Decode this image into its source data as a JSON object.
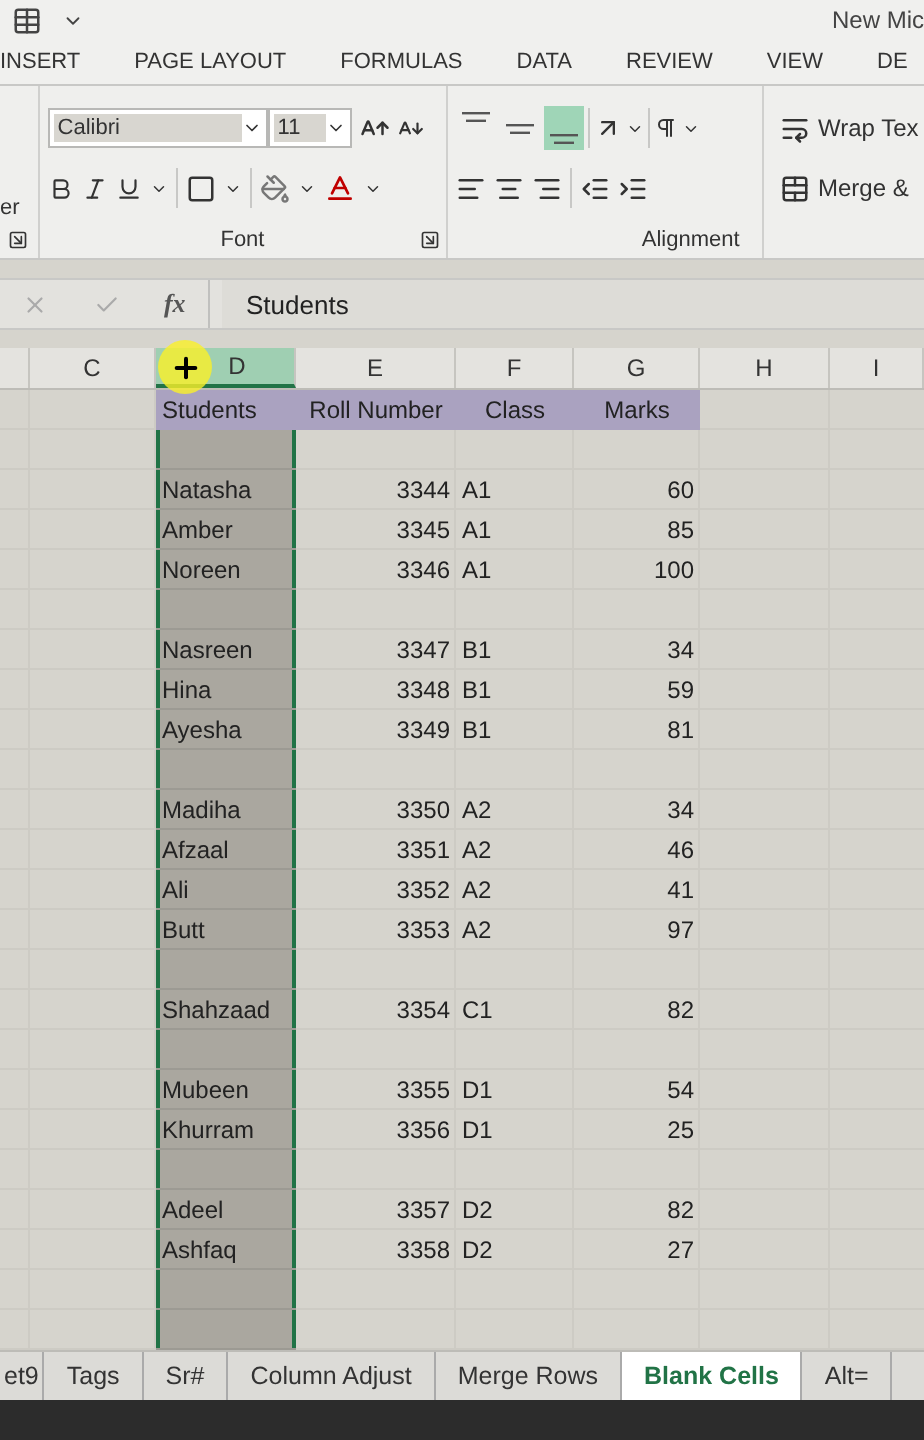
{
  "title_bar": {
    "title": "New Mic"
  },
  "ribbon_tabs": [
    {
      "label": "INSERT",
      "selected": false
    },
    {
      "label": "PAGE LAYOUT",
      "selected": false
    },
    {
      "label": "FORMULAS",
      "selected": false
    },
    {
      "label": "DATA",
      "selected": false
    },
    {
      "label": "REVIEW",
      "selected": false
    },
    {
      "label": "VIEW",
      "selected": false
    },
    {
      "label": "DE",
      "selected": false
    }
  ],
  "ribbon": {
    "cut_label": "er",
    "font_name": "Calibri",
    "font_size": "11",
    "font_group": "Font",
    "alignment_group": "Alignment",
    "wrap_text": "Wrap Tex",
    "merge": "Merge &",
    "vertical_align": [
      {
        "kind": "top",
        "selected": false
      },
      {
        "kind": "middle",
        "selected": false
      },
      {
        "kind": "bottom",
        "selected": true
      }
    ]
  },
  "formula_bar": {
    "function_label": "fx",
    "value": "Students"
  },
  "columns": [
    {
      "label": "C",
      "selected": false
    },
    {
      "label": "D",
      "selected": true
    },
    {
      "label": "E",
      "selected": false
    },
    {
      "label": "F",
      "selected": false
    },
    {
      "label": "G",
      "selected": false
    },
    {
      "label": "H",
      "selected": false
    },
    {
      "label": "I",
      "selected": false
    }
  ],
  "header_row": [
    "Students",
    "Roll Number",
    "Class",
    "Marks"
  ],
  "rows": [
    {
      "kind": "blank"
    },
    {
      "kind": "data",
      "name": "Natasha",
      "roll": "3344",
      "class": "A1",
      "marks": "60"
    },
    {
      "kind": "data",
      "name": "Amber",
      "roll": "3345",
      "class": "A1",
      "marks": "85"
    },
    {
      "kind": "data",
      "name": "Noreen",
      "roll": "3346",
      "class": "A1",
      "marks": "100"
    },
    {
      "kind": "blank"
    },
    {
      "kind": "data",
      "name": "Nasreen",
      "roll": "3347",
      "class": "B1",
      "marks": "34"
    },
    {
      "kind": "data",
      "name": "Hina",
      "roll": "3348",
      "class": "B1",
      "marks": "59"
    },
    {
      "kind": "data",
      "name": "Ayesha",
      "roll": "3349",
      "class": "B1",
      "marks": "81"
    },
    {
      "kind": "blank"
    },
    {
      "kind": "data",
      "name": "Madiha",
      "roll": "3350",
      "class": "A2",
      "marks": "34"
    },
    {
      "kind": "data",
      "name": "Afzaal",
      "roll": "3351",
      "class": "A2",
      "marks": "46"
    },
    {
      "kind": "data",
      "name": "Ali",
      "roll": "3352",
      "class": "A2",
      "marks": "41"
    },
    {
      "kind": "data",
      "name": "Butt",
      "roll": "3353",
      "class": "A2",
      "marks": "97"
    },
    {
      "kind": "blank"
    },
    {
      "kind": "data",
      "name": "Shahzaad",
      "roll": "3354",
      "class": "C1",
      "marks": "82"
    },
    {
      "kind": "blank"
    },
    {
      "kind": "data",
      "name": "Mubeen",
      "roll": "3355",
      "class": "D1",
      "marks": "54"
    },
    {
      "kind": "data",
      "name": "Khurram",
      "roll": "3356",
      "class": "D1",
      "marks": "25"
    },
    {
      "kind": "blank"
    },
    {
      "kind": "data",
      "name": "Adeel",
      "roll": "3357",
      "class": "D2",
      "marks": "82"
    },
    {
      "kind": "data",
      "name": "Ashfaq",
      "roll": "3358",
      "class": "D2",
      "marks": "27"
    },
    {
      "kind": "blank"
    },
    {
      "kind": "blank"
    }
  ],
  "sheet_tabs": [
    {
      "label": "et9",
      "selected": false
    },
    {
      "label": "Tags",
      "selected": false
    },
    {
      "label": "Sr#",
      "selected": false
    },
    {
      "label": "Column Adjust",
      "selected": false
    },
    {
      "label": "Merge Rows",
      "selected": false
    },
    {
      "label": "Blank Cells",
      "selected": true
    },
    {
      "label": "Alt=",
      "selected": false
    }
  ]
}
